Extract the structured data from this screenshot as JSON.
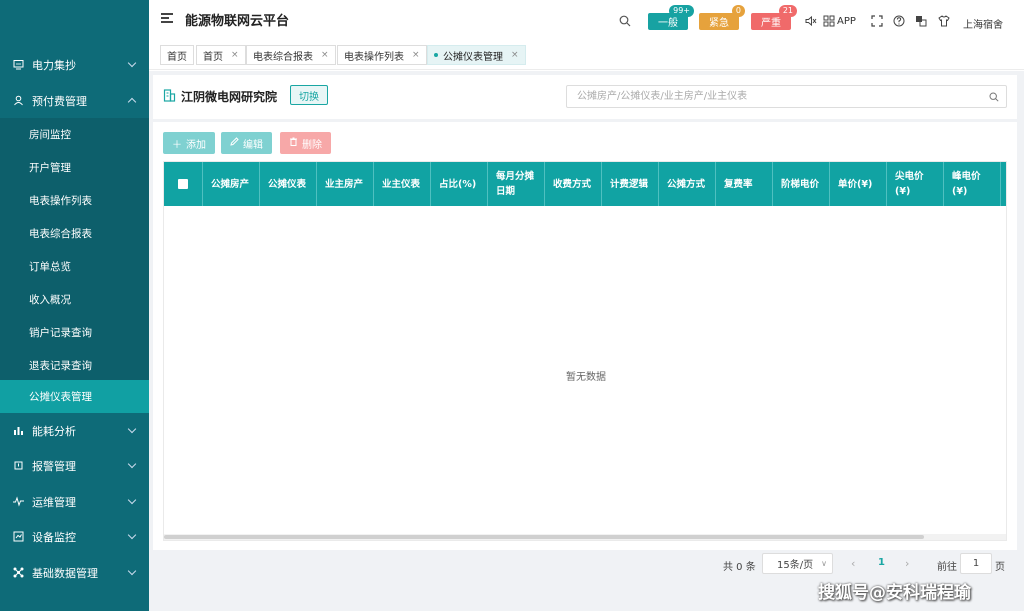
{
  "header": {
    "title": "能源物联网云平台",
    "alerts": [
      {
        "label": "一般",
        "count": "99+",
        "color": "#17a2a2",
        "bubble_color": "#17a2a2"
      },
      {
        "label": "紧急",
        "count": "0",
        "color": "#e6a23c",
        "bubble_color": "#e6a23c"
      },
      {
        "label": "严重",
        "count": "21",
        "color": "#f06a6a",
        "bubble_color": "#f06a6a"
      }
    ],
    "app_label": "APP",
    "user_label": "上海宿舍"
  },
  "sidebar": {
    "items": [
      {
        "label": "电力集抄",
        "icon": "meter-icon"
      },
      {
        "label": "预付费管理",
        "icon": "user-icon",
        "expanded": true
      },
      {
        "label": "能耗分析",
        "icon": "chart-icon"
      },
      {
        "label": "报警管理",
        "icon": "alarm-icon"
      },
      {
        "label": "运维管理",
        "icon": "wave-icon"
      },
      {
        "label": "设备监控",
        "icon": "monitor-icon"
      },
      {
        "label": "基础数据管理",
        "icon": "network-icon"
      }
    ],
    "sub_items": [
      "房间监控",
      "开户管理",
      "电表操作列表",
      "电表综合报表",
      "订单总览",
      "收入概况",
      "销户记录查询",
      "退表记录查询",
      "公摊仪表管理"
    ],
    "active_sub": "公摊仪表管理"
  },
  "tabs": [
    {
      "label": "首页",
      "closable": false
    },
    {
      "label": "首页",
      "closable": true
    },
    {
      "label": "电表综合报表",
      "closable": true
    },
    {
      "label": "电表操作列表",
      "closable": true
    },
    {
      "label": "公摊仪表管理",
      "closable": true,
      "active": true
    }
  ],
  "org": {
    "name": "江阴微电网研究院",
    "switch_label": "切换",
    "search_placeholder": "公摊房产/公摊仪表/业主房产/业主仪表"
  },
  "toolbar": {
    "add_label": "添加",
    "edit_label": "编辑",
    "delete_label": "删除"
  },
  "table": {
    "columns": [
      "公摊房产",
      "公摊仪表",
      "业主房产",
      "业主仪表",
      "占比(%)",
      "每月分摊日期",
      "收费方式",
      "计费逻辑",
      "公摊方式",
      "复费率",
      "阶梯电价",
      "单价(¥)",
      "尖电价(¥)",
      "峰电价(¥)"
    ],
    "empty_text": "暂无数据"
  },
  "pagination": {
    "total": "共 0 条",
    "page_size": "15条/页",
    "current": "1",
    "goto_label": "前往",
    "goto_value": "1",
    "page_suffix": "页"
  },
  "watermark": "搜狐号@安科瑞程瑜"
}
